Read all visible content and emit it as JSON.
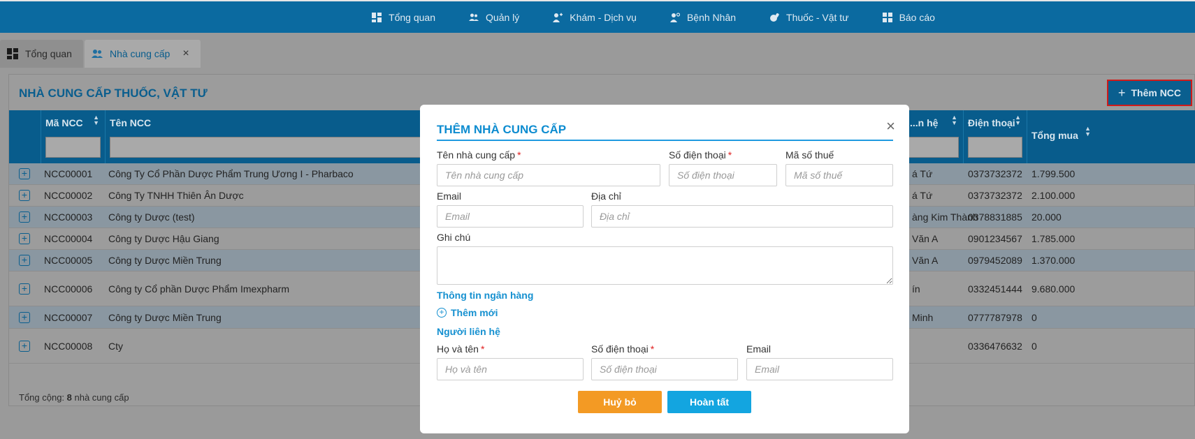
{
  "nav": {
    "items": [
      {
        "label": "Tổng quan",
        "icon": "dashboard-icon"
      },
      {
        "label": "Quản lý",
        "icon": "users-icon"
      },
      {
        "label": "Khám - Dịch vụ",
        "icon": "doctor-icon"
      },
      {
        "label": "Bệnh Nhân",
        "icon": "patient-icon"
      },
      {
        "label": "Thuốc - Vật tư",
        "icon": "medicine-icon"
      },
      {
        "label": "Báo cáo",
        "icon": "report-icon"
      }
    ]
  },
  "tabs": [
    {
      "label": "Tổng quan",
      "icon": "dashboard-icon",
      "active": false
    },
    {
      "label": "Nhà cung cấp",
      "icon": "users-icon",
      "active": true,
      "close": "×"
    }
  ],
  "page": {
    "title": "NHÀ CUNG CẤP THUỐC, VẬT TƯ",
    "add_button": {
      "plus": "+",
      "label": "Thêm NCC"
    }
  },
  "table": {
    "columns": [
      "Mã NCC",
      "Tên NCC",
      "...n hệ",
      "Điện thoại",
      "Tổng mua"
    ],
    "rows": [
      {
        "code": "NCC00001",
        "name": "Công Ty Cổ Phần Dược Phẩm Trung Ương I - Pharbaco",
        "contact": "á Tứ",
        "phone": "0373732372",
        "total": "1.799.500"
      },
      {
        "code": "NCC00002",
        "name": "Công Ty TNHH Thiên Ân Dược",
        "contact": "á Tứ",
        "phone": "0373732372",
        "total": "2.100.000"
      },
      {
        "code": "NCC00003",
        "name": "Công ty Dược (test)",
        "contact": "àng Kim Thành",
        "phone": "0378831885",
        "total": "20.000"
      },
      {
        "code": "NCC00004",
        "name": "Công ty Dược Hậu Giang",
        "contact": "Văn A",
        "phone": "0901234567",
        "total": "1.785.000"
      },
      {
        "code": "NCC00005",
        "name": "Công ty Dược Miền Trung",
        "contact": "Văn A",
        "phone": "0979452089",
        "total": "1.370.000"
      },
      {
        "code": "NCC00006",
        "name": "Công ty Cổ phần Dược Phẩm Imexpharm",
        "contact": "ín",
        "phone": "0332451444",
        "total": "9.680.000"
      },
      {
        "code": "NCC00007",
        "name": "Công ty Dược Miền Trung",
        "contact": "Minh",
        "phone": "0777787978",
        "total": "0"
      },
      {
        "code": "NCC00008",
        "name": "Cty",
        "contact": "",
        "phone": "0336476632",
        "total": "0"
      }
    ],
    "footer_prefix": "Tổng cộng: ",
    "footer_count": "8",
    "footer_suffix": " nhà cung cấp"
  },
  "modal": {
    "title": "THÊM NHÀ CUNG CẤP",
    "close": "×",
    "fields": {
      "name": {
        "label": "Tên nhà cung cấp",
        "placeholder": "Tên nhà cung cấp",
        "required": "*"
      },
      "phone": {
        "label": "Số điện thoại",
        "placeholder": "Số điện thoại",
        "required": "*"
      },
      "tax": {
        "label": "Mã số thuế",
        "placeholder": "Mã số thuế"
      },
      "email": {
        "label": "Email",
        "placeholder": "Email"
      },
      "address": {
        "label": "Địa chỉ",
        "placeholder": "Địa chỉ"
      },
      "note": {
        "label": "Ghi chú"
      }
    },
    "bank_section": "Thông tin ngân hàng",
    "add_new": "Thêm mới",
    "contact_section": "Người liên hệ",
    "contact_fields": {
      "fullname": {
        "label": "Họ và tên",
        "placeholder": "Họ và tên",
        "required": "*"
      },
      "phone": {
        "label": "Số điện thoại",
        "placeholder": "Số điện thoại",
        "required": "*"
      },
      "email": {
        "label": "Email",
        "placeholder": "Email"
      }
    },
    "cancel": "Huỷ bỏ",
    "submit": "Hoàn tất"
  },
  "colors": {
    "brand": "#0b6aa0",
    "accent": "#13a5e0",
    "cancel": "#f39a24",
    "required": "#e02020"
  }
}
